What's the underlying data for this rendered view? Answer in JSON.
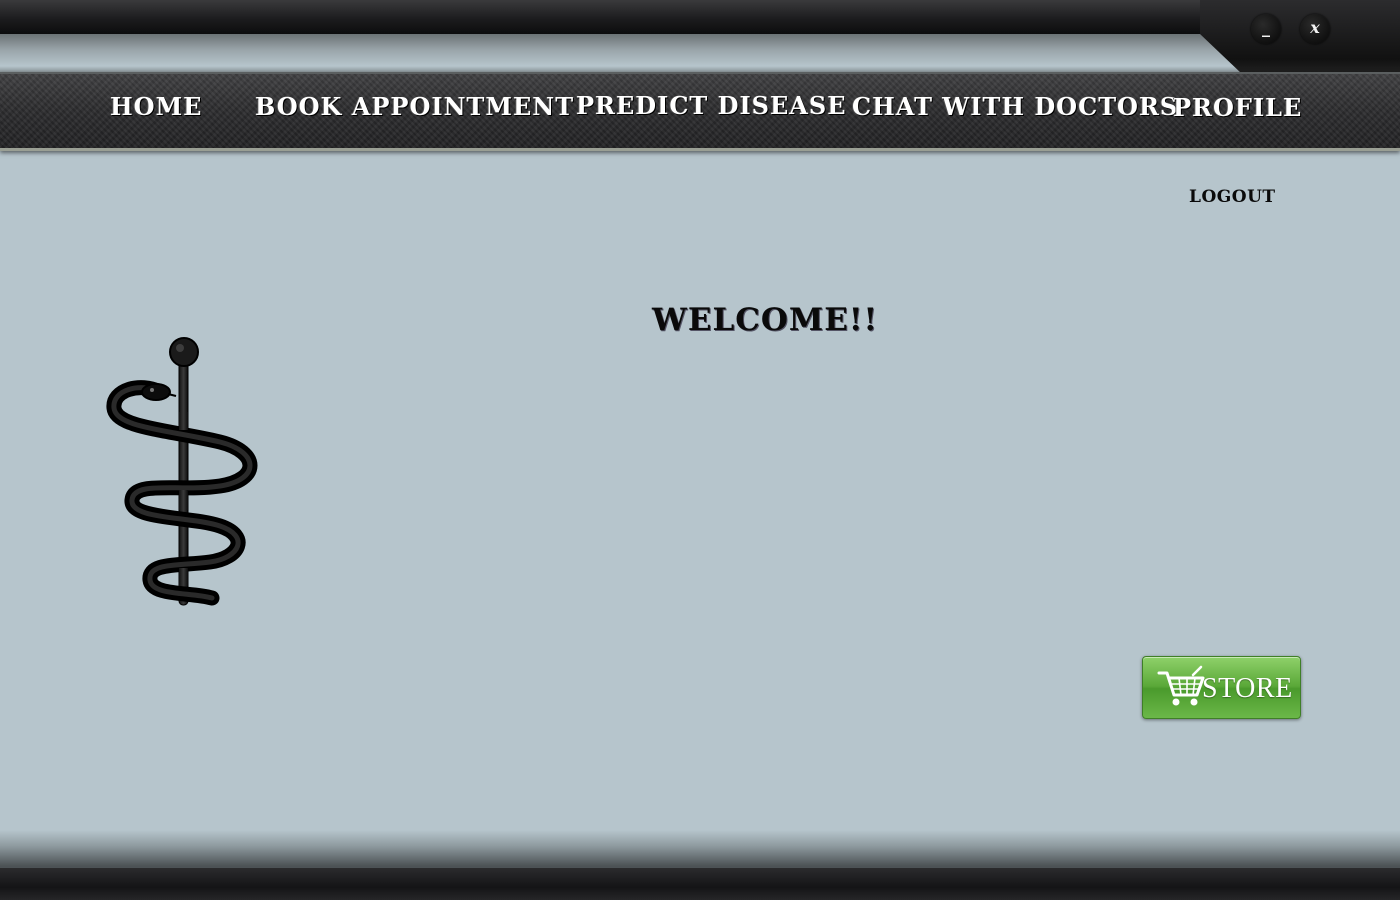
{
  "window": {
    "minimize_label": "_",
    "close_label": "x"
  },
  "nav": {
    "home": "HOME",
    "book_appointment": "BOOK APPOINTMENT",
    "predict_disease": "PREDICT DISEASE",
    "chat_with_doctors": "CHAT WITH DOCTORS",
    "profile": "PROFILE"
  },
  "main": {
    "logout_label": "LOGOUT",
    "welcome_text": "WELCOME!!",
    "store_label": "STORE",
    "logo_icon": "rod-of-asclepius-icon",
    "store_icon": "shopping-cart-icon"
  },
  "colors": {
    "background": "#b6c5cc",
    "nav_bar": "#2c2c2e",
    "store_button": "#5aa838"
  }
}
